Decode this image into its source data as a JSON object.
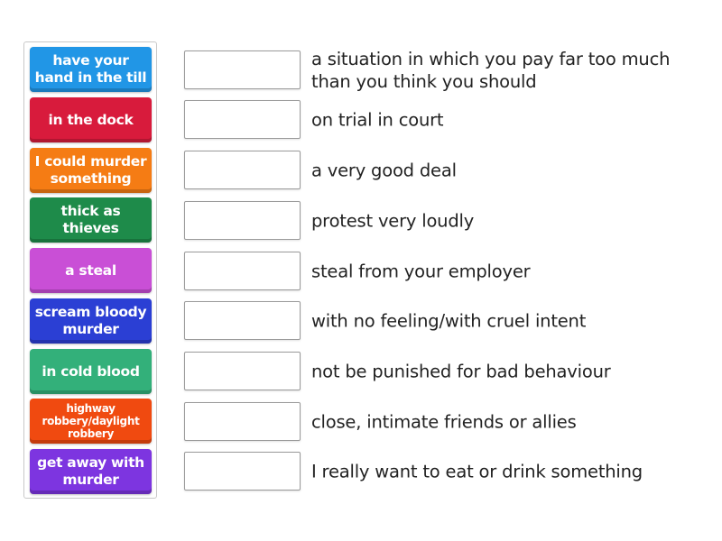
{
  "tiles": [
    {
      "label": "have your hand in the till",
      "color": "#2196e6"
    },
    {
      "label": "in the dock",
      "color": "#d81b3c"
    },
    {
      "label": "I could murder something",
      "color": "#f57c14"
    },
    {
      "label": "thick as thieves",
      "color": "#1e8b4a"
    },
    {
      "label": "a steal",
      "color": "#c94fd6"
    },
    {
      "label": "scream bloody murder",
      "color": "#2b3fd4"
    },
    {
      "label": "in cold blood",
      "color": "#33b07a"
    },
    {
      "label": "highway robbery/daylight robbery",
      "color": "#f04a10"
    },
    {
      "label": "get away with murder",
      "color": "#7d35e0"
    }
  ],
  "definitions": [
    "a situation in which you pay far too much than you think you should",
    "on trial in court",
    "a very good deal",
    "protest very loudly",
    "steal from your employer",
    "with no feeling/with cruel intent",
    "not be punished for bad behaviour",
    "close, intimate friends or allies",
    "I really want to eat or drink something"
  ]
}
